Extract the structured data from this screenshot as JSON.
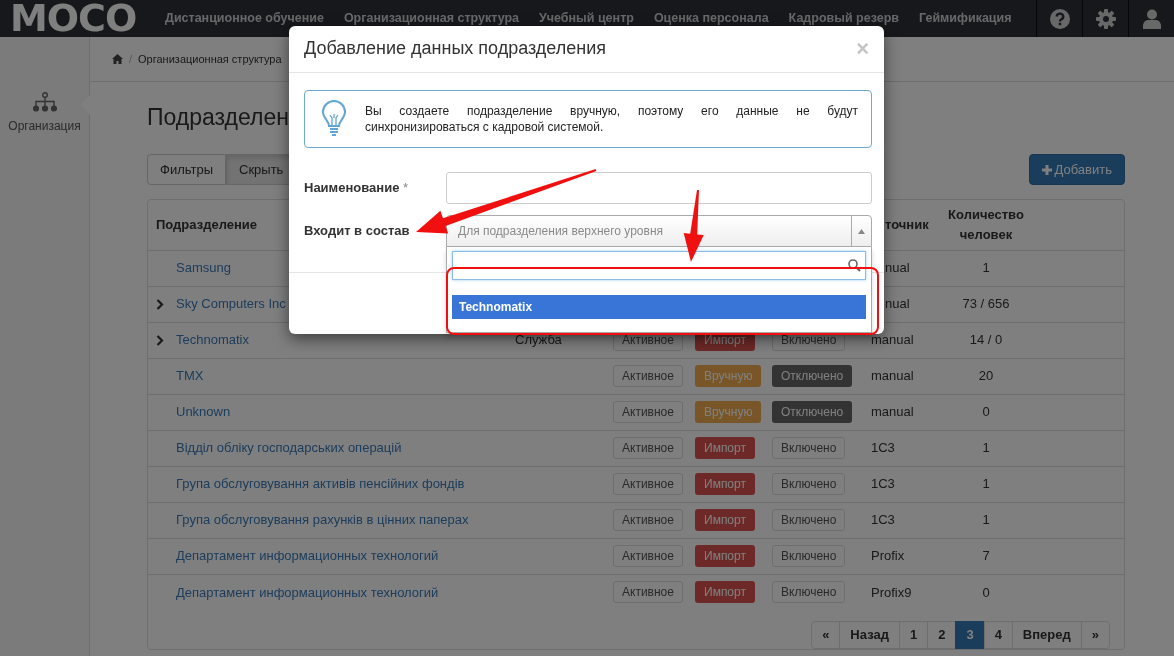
{
  "navbar": {
    "logo": "MOCO",
    "items": [
      "Дистанционное обучение",
      "Организационная структура",
      "Учебный центр",
      "Оценка персонала",
      "Кадровый резерв",
      "Геймификация"
    ]
  },
  "sidebar": {
    "items": [
      {
        "label": "Организация",
        "selected": true
      }
    ]
  },
  "breadcrumb": {
    "separator": "/",
    "items": [
      "Организационная структура"
    ]
  },
  "page": {
    "title": "Подразделен",
    "filters": [
      {
        "label": "Фильтры",
        "selected": false
      },
      {
        "label": "Скрыть",
        "selected": true
      }
    ],
    "add_button": "Добавить"
  },
  "table": {
    "header": {
      "name": "Подразделение",
      "source": "точник",
      "count": "Количество человек"
    },
    "rows": [
      {
        "name": "Samsung",
        "expandable": false,
        "source": "nual",
        "count": "1"
      },
      {
        "name": "Sky Computers Inc",
        "expandable": true,
        "source": "nual",
        "count": "73 / 656"
      },
      {
        "name": "Technomatix",
        "expandable": true,
        "type": "Служба",
        "status": "Активное",
        "origin": {
          "text": "Импорт",
          "kind": "import"
        },
        "sync": {
          "text": "Включено",
          "enabled": true
        },
        "source": "manual",
        "count": "14 / 0"
      },
      {
        "name": "TMX",
        "expandable": false,
        "status": "Активное",
        "origin": {
          "text": "Вручную",
          "kind": "manual"
        },
        "sync": {
          "text": "Отключено",
          "enabled": false
        },
        "source": "manual",
        "count": "20"
      },
      {
        "name": "Unknown",
        "expandable": false,
        "status": "Активное",
        "origin": {
          "text": "Вручную",
          "kind": "manual"
        },
        "sync": {
          "text": "Отключено",
          "enabled": false
        },
        "source": "manual",
        "count": "0"
      },
      {
        "name": "Відділ обліку господарських операцій",
        "expandable": false,
        "status": "Активное",
        "origin": {
          "text": "Импорт",
          "kind": "import"
        },
        "sync": {
          "text": "Включено",
          "enabled": true
        },
        "source": "1C3",
        "count": "1"
      },
      {
        "name": "Група обслуговування активів пенсійних фондів",
        "expandable": false,
        "status": "Активное",
        "origin": {
          "text": "Импорт",
          "kind": "import"
        },
        "sync": {
          "text": "Включено",
          "enabled": true
        },
        "source": "1C3",
        "count": "1"
      },
      {
        "name": "Група обслуговування рахунків в цінних паперах",
        "expandable": false,
        "status": "Активное",
        "origin": {
          "text": "Импорт",
          "kind": "import"
        },
        "sync": {
          "text": "Включено",
          "enabled": true
        },
        "source": "1C3",
        "count": "1"
      },
      {
        "name": "Департамент информационных технологий",
        "expandable": false,
        "status": "Активное",
        "origin": {
          "text": "Импорт",
          "kind": "import"
        },
        "sync": {
          "text": "Включено",
          "enabled": true
        },
        "source": "Profix",
        "count": "7"
      },
      {
        "name": "Департамент информационных технологий",
        "expandable": false,
        "status": "Активное",
        "origin": {
          "text": "Импорт",
          "kind": "import"
        },
        "sync": {
          "text": "Включено",
          "enabled": true
        },
        "source": "Profix9",
        "count": "0"
      }
    ]
  },
  "pagination": [
    {
      "label": "«",
      "selected": false
    },
    {
      "label": "Назад",
      "selected": false
    },
    {
      "label": "1",
      "selected": false
    },
    {
      "label": "2",
      "selected": false
    },
    {
      "label": "3",
      "selected": true
    },
    {
      "label": "4",
      "selected": false
    },
    {
      "label": "Вперед",
      "selected": false
    },
    {
      "label": "»",
      "selected": false
    }
  ],
  "modal": {
    "title": "Добавление данных подразделения",
    "close": "×",
    "notice": "Вы создаете подразделение вручную, поэтому его данные не будут синхронизироваться с кадровой системой.",
    "fields": [
      {
        "kind": "text",
        "label": "Наименование",
        "mark": "*"
      },
      {
        "kind": "select",
        "label": "Входит в состав",
        "placeholder": "Для подразделения верхнего уровня",
        "expanded": true,
        "options": [
          {
            "label": "Technomatix",
            "selected": true
          }
        ]
      }
    ]
  }
}
